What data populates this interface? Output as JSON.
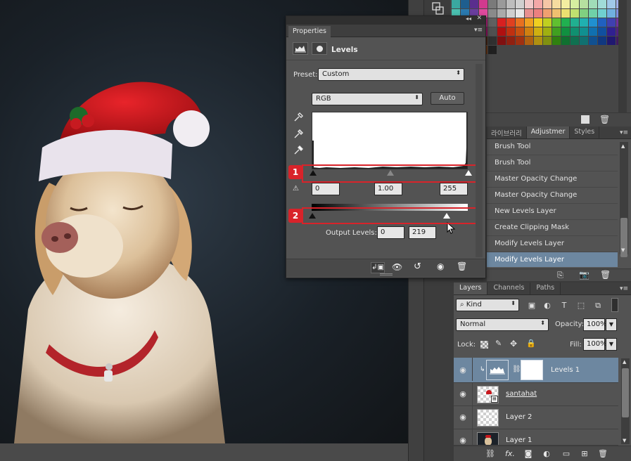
{
  "properties": {
    "tab_label": "Properties",
    "panel_title": "Levels",
    "preset_label": "Preset:",
    "preset_value": "Custom",
    "channel_value": "RGB",
    "auto_label": "Auto",
    "input_black": "0",
    "input_gamma": "1.00",
    "input_white": "255",
    "output_label": "Output Levels:",
    "output_black": "0",
    "output_white": "219",
    "callout_1": "1",
    "callout_2": "2"
  },
  "history": {
    "tabs": [
      "라이브러리",
      "Adjustmer",
      "Styles"
    ],
    "items": [
      "Brush Tool",
      "Brush Tool",
      "Master Opacity Change",
      "Master Opacity Change",
      "New Levels Layer",
      "Create Clipping Mask",
      "Modify Levels Layer",
      "Modify Levels Layer"
    ],
    "selected_index": 7
  },
  "layers": {
    "tabs": [
      "Layers",
      "Channels",
      "Paths"
    ],
    "filter_kind": "Kind",
    "blend_mode": "Normal",
    "opacity_label": "Opacity:",
    "opacity_value": "100%",
    "lock_label": "Lock:",
    "fill_label": "Fill:",
    "fill_value": "100%",
    "rows": [
      {
        "name": "Levels 1",
        "selected": true
      },
      {
        "name": "santahat",
        "selected": false
      },
      {
        "name": "Layer 2",
        "selected": false
      },
      {
        "name": "Layer 1",
        "selected": false
      }
    ]
  },
  "colors": {
    "selection_blue": "#6d87a0",
    "highlight_red": "#d8232a",
    "panel_bg": "#535353"
  }
}
